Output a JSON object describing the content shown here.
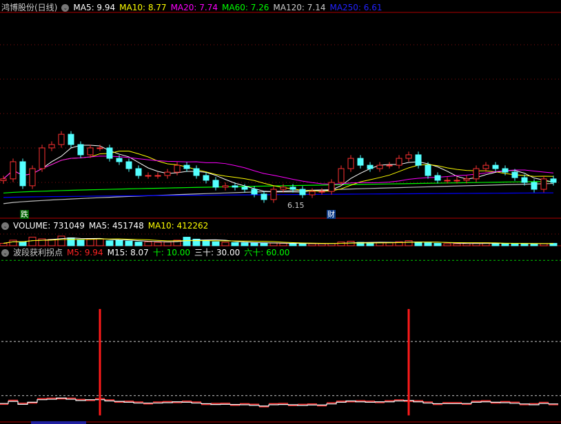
{
  "header": {
    "title": "鸿博股份(日线)",
    "ma5": "MA5: 9.94",
    "ma10": "MA10: 8.77",
    "ma20": "MA20: 7.74",
    "ma60": "MA60: 7.26",
    "ma120": "MA120: 7.14",
    "ma250": "MA250: 6.61"
  },
  "volume_header": {
    "volume": "VOLUME: 731049",
    "ma5": "MA5: 451748",
    "ma10": "MA10: 412262"
  },
  "indicator_header": {
    "name": "波段获利拐点",
    "m5": "M5: 9.94",
    "m15": "M15: 8.07",
    "ten": "十: 10.00",
    "thirty": "三十: 30.00",
    "sixty": "六十: 60.00"
  },
  "markers": {
    "die": "跌",
    "cai": "财",
    "low_label": "6.15"
  },
  "colors": {
    "up": "#ff3232",
    "down": "#54ffff",
    "ma5": "#ffffff",
    "ma10": "#ffff00",
    "ma20": "#ff00ff",
    "ma60": "#00ff00",
    "ma120": "#c0c0c0",
    "ma250": "#0000ff",
    "frame": "#b00000"
  },
  "chart_data": {
    "type": "candlestick",
    "closes": [
      7.4,
      8.37,
      7.01,
      7.98,
      9.15,
      9.34,
      9.92,
      9.34,
      8.76,
      9.15,
      9.15,
      8.56,
      8.37,
      7.98,
      7.59,
      7.59,
      7.59,
      7.78,
      8.17,
      7.98,
      7.59,
      7.32,
      6.93,
      7.01,
      6.93,
      6.81,
      6.54,
      6.23,
      6.81,
      6.93,
      6.81,
      6.5,
      6.69,
      6.69,
      7.2,
      7.98,
      8.56,
      8.17,
      7.98,
      8.17,
      8.17,
      8.56,
      8.76,
      8.17,
      7.59,
      7.32,
      7.32,
      7.32,
      7.4,
      7.98,
      8.17,
      7.98,
      7.78,
      7.47,
      7.2,
      6.81,
      7.4,
      7.2
    ],
    "volumes": [
      180000,
      420000,
      300000,
      650000,
      520000,
      480000,
      731049,
      600000,
      430000,
      500000,
      520000,
      380000,
      400000,
      350000,
      280000,
      300000,
      260000,
      280000,
      420000,
      650000,
      500000,
      380000,
      300000,
      260000,
      240000,
      220000,
      200000,
      180000,
      200000,
      180000,
      170000,
      160000,
      150000,
      150000,
      170000,
      280000,
      340000,
      260000,
      220000,
      240000,
      230000,
      300000,
      380000,
      280000,
      220000,
      180000,
      160000,
      150000,
      160000,
      200000,
      220000,
      180000,
      170000,
      160000,
      150000,
      140000,
      150000,
      180000
    ],
    "ma60_range": [
      6.6,
      7.26
    ],
    "ma120_range": [
      6.0,
      7.14
    ],
    "ma250_range": [
      6.35,
      6.61
    ],
    "signals": [
      10,
      42
    ],
    "indicator_levels": [
      10,
      30,
      60
    ],
    "indicator_base": 7,
    "signal_value": 42,
    "price_low": 6.15
  }
}
